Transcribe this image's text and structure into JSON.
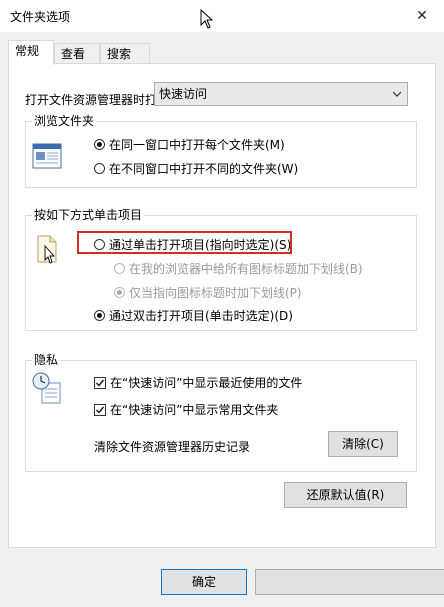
{
  "window": {
    "title": "文件夹选项",
    "close_glyph": "✕"
  },
  "tabs": [
    {
      "label": "常规"
    },
    {
      "label": "查看"
    },
    {
      "label": "搜索"
    }
  ],
  "general": {
    "open_label": "打开文件资源管理器时打",
    "open_value": "快速访问",
    "browse": {
      "title": "浏览文件夹",
      "same_window": "在同一窗口中打开每个文件夹(M)",
      "new_window": "在不同窗口中打开不同的文件夹(W)",
      "selected": "same_window"
    },
    "click": {
      "title": "按如下方式单击项目",
      "single": "通过单击打开项目(指向时选定)(S)",
      "underline_all": "在我的浏览器中给所有图标标题加下划线(B)",
      "underline_hover": "仅当指向图标标题时加下划线(P)",
      "double": "通过双击打开项目(单击时选定)(D)",
      "selected": "double"
    },
    "privacy": {
      "title": "隐私",
      "recent_files": "在“快速访问”中显示最近使用的文件",
      "frequent_folders": "在“快速访问”中显示常用文件夹",
      "recent_checked": true,
      "frequent_checked": true,
      "clear_label": "清除文件资源管理器历史记录",
      "clear_button": "清除(C)"
    },
    "restore_defaults": "还原默认值(R)"
  },
  "footer": {
    "ok": "确定"
  },
  "colors": {
    "highlight": "#d0302c"
  }
}
